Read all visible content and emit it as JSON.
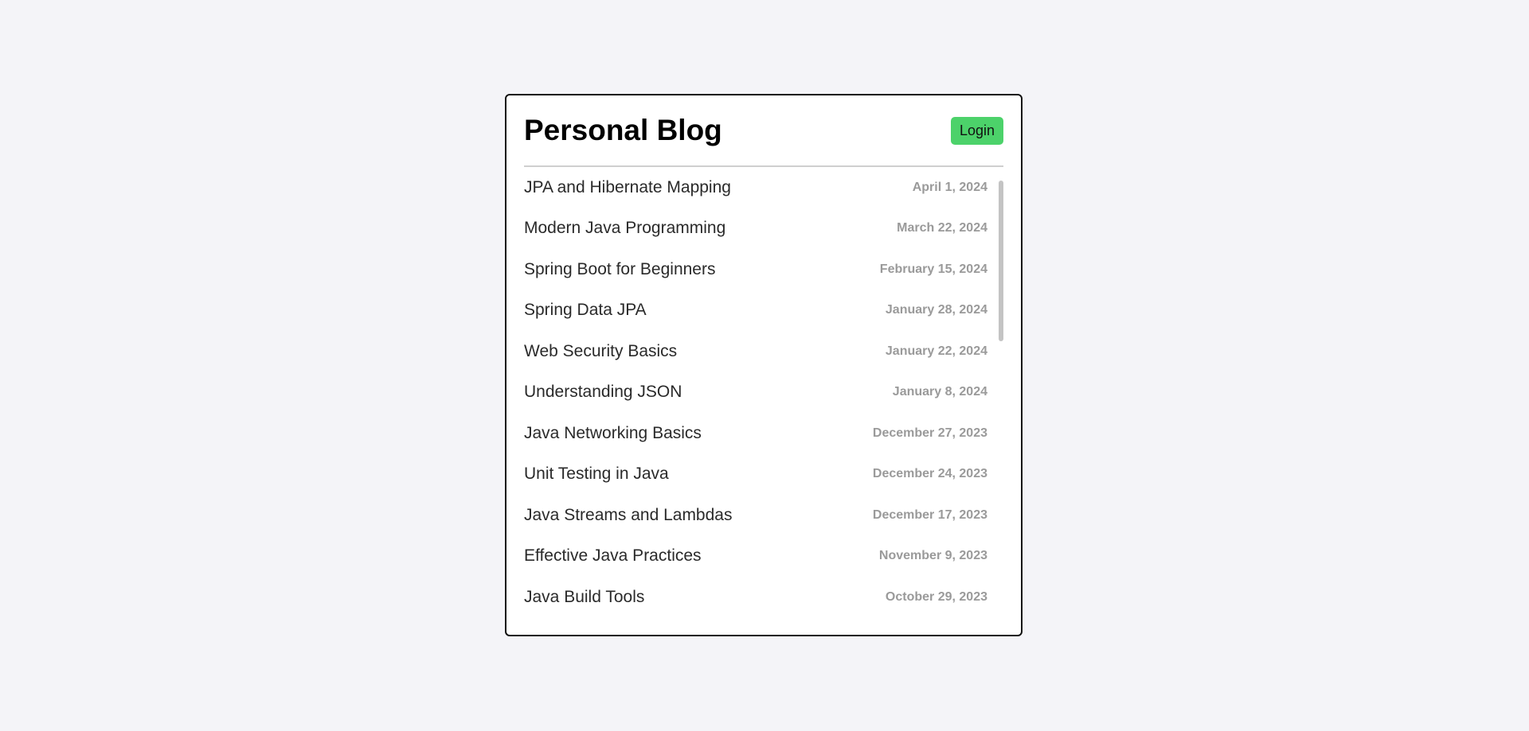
{
  "header": {
    "title": "Personal Blog",
    "login_label": "Login",
    "login_color": "#4cd26a"
  },
  "posts": [
    {
      "title": "JPA and Hibernate Mapping",
      "date": "April 1, 2024"
    },
    {
      "title": "Modern Java Programming",
      "date": "March 22, 2024"
    },
    {
      "title": "Spring Boot for Beginners",
      "date": "February 15, 2024"
    },
    {
      "title": "Spring Data JPA",
      "date": "January 28, 2024"
    },
    {
      "title": "Web Security Basics",
      "date": "January 22, 2024"
    },
    {
      "title": "Understanding JSON",
      "date": "January 8, 2024"
    },
    {
      "title": "Java Networking Basics",
      "date": "December 27, 2023"
    },
    {
      "title": "Unit Testing in Java",
      "date": "December 24, 2023"
    },
    {
      "title": "Java Streams and Lambdas",
      "date": "December 17, 2023"
    },
    {
      "title": "Effective Java Practices",
      "date": "November 9, 2023"
    },
    {
      "title": "Java Build Tools",
      "date": "October 29, 2023"
    }
  ]
}
